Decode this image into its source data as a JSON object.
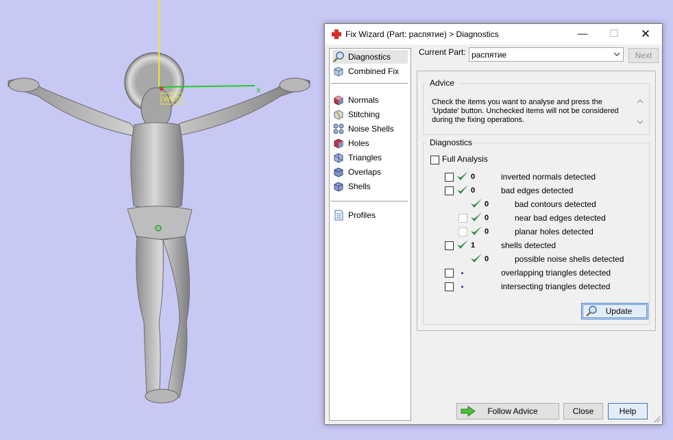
{
  "viewport": {
    "background": "#c8c8f5",
    "axis_label_x": "x",
    "tag_text": "WCS"
  },
  "dialog": {
    "title": "Fix Wizard (Part: распятие) > Diagnostics",
    "window_buttons": {
      "minimize": "—",
      "maximize": "☐",
      "close": "✕"
    },
    "nav": {
      "top_items": [
        {
          "label": "Diagnostics",
          "icon": "magnifier-icon",
          "selected": true
        },
        {
          "label": "Combined Fix",
          "icon": "combined-fix-icon"
        }
      ],
      "tool_items": [
        {
          "label": "Normals",
          "icon": "normals-cube-icon"
        },
        {
          "label": "Stitching",
          "icon": "stitching-cube-icon"
        },
        {
          "label": "Noise Shells",
          "icon": "noise-shells-icon"
        },
        {
          "label": "Holes",
          "icon": "holes-cube-icon"
        },
        {
          "label": "Triangles",
          "icon": "triangles-cube-icon"
        },
        {
          "label": "Overlaps",
          "icon": "overlaps-cube-icon"
        },
        {
          "label": "Shells",
          "icon": "shells-cube-icon"
        }
      ],
      "bottom_items": [
        {
          "label": "Profiles",
          "icon": "document-icon"
        }
      ]
    },
    "current_part": {
      "label": "Current Part:",
      "value": "распятие"
    },
    "next_label": "Next",
    "advice": {
      "title": "Advice",
      "text": "Check the items you want to analyse and press the 'Update' button. Unchecked items will not be considered during the fixing operations."
    },
    "diagnostics": {
      "title": "Diagnostics",
      "full_analysis_label": "Full Analysis",
      "rows": [
        {
          "count": "0",
          "label": "inverted normals detected",
          "status": "ok"
        },
        {
          "count": "0",
          "label": "bad edges detected",
          "status": "ok"
        },
        {
          "count": "0",
          "label": "bad contours detected",
          "status": "ok"
        },
        {
          "count": "0",
          "label": "near bad edges detected",
          "status": "ok"
        },
        {
          "count": "0",
          "label": "planar holes detected",
          "status": "ok"
        },
        {
          "count": "1",
          "label": "shells detected",
          "status": "ok"
        },
        {
          "count": "0",
          "label": "possible noise shells detected",
          "status": "ok"
        },
        {
          "count": "",
          "label": "overlapping triangles detected",
          "status": "unknown"
        },
        {
          "count": "",
          "label": "intersecting triangles detected",
          "status": "unknown"
        }
      ],
      "update_label": "Update"
    },
    "buttons": {
      "follow_advice": "Follow Advice",
      "close": "Close",
      "help": "Help"
    },
    "colors": {
      "check_green": "#2e8b3e",
      "accent_blue": "#3a74c8"
    }
  }
}
